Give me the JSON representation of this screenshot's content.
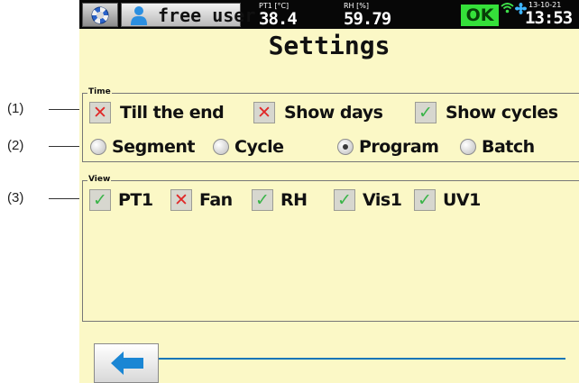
{
  "callouts": [
    "(1)",
    "(2)",
    "(3)"
  ],
  "statusbar": {
    "home_icon": "lifebuoy-icon",
    "user_label": "free user",
    "user_icon": "user-icon",
    "pt1_caption": "PT1 [°C]",
    "pt1_value": "38.4",
    "rh_caption": "RH [%]",
    "rh_value": "59.79",
    "ok_label": "OK",
    "date": "13-10-21",
    "time": "13:53"
  },
  "title": "Settings",
  "time_group": {
    "legend": "Time",
    "checkboxes": [
      {
        "label": "Till the end",
        "checked": false
      },
      {
        "label": "Show days",
        "checked": false
      },
      {
        "label": "Show cycles",
        "checked": true
      }
    ],
    "radios": [
      {
        "label": "Segment",
        "selected": false
      },
      {
        "label": "Cycle",
        "selected": false
      },
      {
        "label": "Program",
        "selected": true
      },
      {
        "label": "Batch",
        "selected": false
      }
    ]
  },
  "view_group": {
    "legend": "View",
    "checkboxes": [
      {
        "label": "PT1",
        "checked": true
      },
      {
        "label": "Fan",
        "checked": false
      },
      {
        "label": "RH",
        "checked": true
      },
      {
        "label": "Vis1",
        "checked": true
      },
      {
        "label": "UV1",
        "checked": true
      }
    ]
  },
  "back_icon": "arrow-left-icon",
  "colors": {
    "background": "#fbf8c6",
    "statusbar": "#070707",
    "ok": "#35e03a",
    "check": "#39b448",
    "cross": "#e02828",
    "accent_line": "#1576b8",
    "back_arrow": "#1a86d4"
  }
}
